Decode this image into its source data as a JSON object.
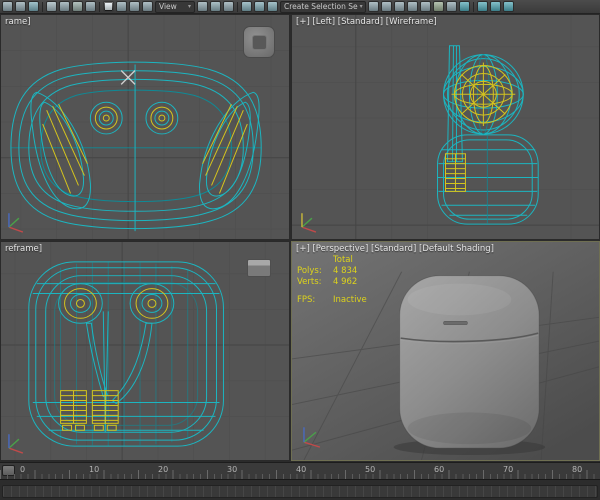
{
  "colors": {
    "wireframe": "#1cb5c0",
    "wireframe_dark": "#0f8a96",
    "highlight": "#d4c41e",
    "stats_text": "#ddd31b",
    "viewport_bg": "#545454"
  },
  "toolbar": {
    "items": [
      {
        "type": "icon",
        "name": "select-and-link",
        "color": "#8da3ab"
      },
      {
        "type": "icon",
        "name": "unlink-selection",
        "color": "#8da3ab"
      },
      {
        "type": "icon",
        "name": "bind-to-space-warp",
        "color": "#79a9b5"
      },
      {
        "type": "sep"
      },
      {
        "type": "icon",
        "name": "select-object",
        "color": "#9fb3ba"
      },
      {
        "type": "icon",
        "name": "select-by-name",
        "color": "#8da3ab"
      },
      {
        "type": "icon",
        "name": "rectangular-selection-region",
        "color": "#93a8a2"
      },
      {
        "type": "icon",
        "name": "window-crossing-toggle",
        "color": "#8da3ab"
      },
      {
        "type": "sep"
      },
      {
        "type": "icon",
        "name": "select-and-move",
        "color": "#aab2b6",
        "pressed": true
      },
      {
        "type": "icon",
        "name": "select-and-rotate",
        "color": "#8da3ab"
      },
      {
        "type": "icon",
        "name": "select-and-scale",
        "color": "#8da3ab"
      },
      {
        "type": "icon",
        "name": "select-and-place",
        "color": "#8da3ab"
      },
      {
        "type": "dropdown",
        "name": "reference-coordinate-system",
        "label": "View",
        "width": 40
      },
      {
        "type": "icon",
        "name": "use-pivot-point-center",
        "color": "#8da3ab"
      },
      {
        "type": "icon",
        "name": "select-and-manipulate",
        "color": "#88a6ae"
      },
      {
        "type": "icon",
        "name": "keyboard-shortcut-override",
        "color": "#8da3ab"
      },
      {
        "type": "sep"
      },
      {
        "type": "icon",
        "name": "snaps-toggle",
        "color": "#7fa8b2"
      },
      {
        "type": "icon",
        "name": "angle-snap-toggle",
        "color": "#7fa8b2"
      },
      {
        "type": "icon",
        "name": "percent-snap-toggle",
        "color": "#7fa8b2"
      },
      {
        "type": "dropdown",
        "name": "named-selection-sets",
        "label": "Create Selection Se",
        "width": 86
      },
      {
        "type": "icon",
        "name": "mirror",
        "color": "#8da3ab"
      },
      {
        "type": "icon",
        "name": "align",
        "color": "#8da3ab"
      },
      {
        "type": "icon",
        "name": "toggle-scene-explorer",
        "color": "#8da3ab"
      },
      {
        "type": "icon",
        "name": "toggle-layer-explorer",
        "color": "#8da3ab"
      },
      {
        "type": "icon",
        "name": "toggle-ribbon",
        "color": "#8da3ab"
      },
      {
        "type": "icon",
        "name": "curve-editor",
        "color": "#95a88f"
      },
      {
        "type": "icon",
        "name": "schematic-view",
        "color": "#8da3ab"
      },
      {
        "type": "icon",
        "name": "material-editor",
        "color": "#4fa7b5"
      },
      {
        "type": "sep"
      },
      {
        "type": "icon",
        "name": "render-setup",
        "color": "#4fa7b5"
      },
      {
        "type": "icon",
        "name": "rendered-frame-window",
        "color": "#4fa7b5"
      },
      {
        "type": "icon",
        "name": "render-production",
        "color": "#4fa7b5"
      }
    ]
  },
  "viewports": {
    "top": {
      "label": "rame]"
    },
    "left": {
      "label": "[+] [Left] [Standard] [Wireframe]"
    },
    "front": {
      "label": "reframe]"
    },
    "persp": {
      "label": "[+] [Perspective] [Standard] [Default Shading]"
    }
  },
  "stats": {
    "total_label": "Total",
    "polys_label": "Polys:",
    "polys_value": "4 834",
    "verts_label": "Verts:",
    "verts_value": "4 962",
    "fps_label": "FPS:",
    "fps_value": "Inactive"
  },
  "timeline": {
    "ticks": [
      "0",
      "10",
      "20",
      "30",
      "40",
      "50",
      "60",
      "70",
      "80"
    ]
  }
}
